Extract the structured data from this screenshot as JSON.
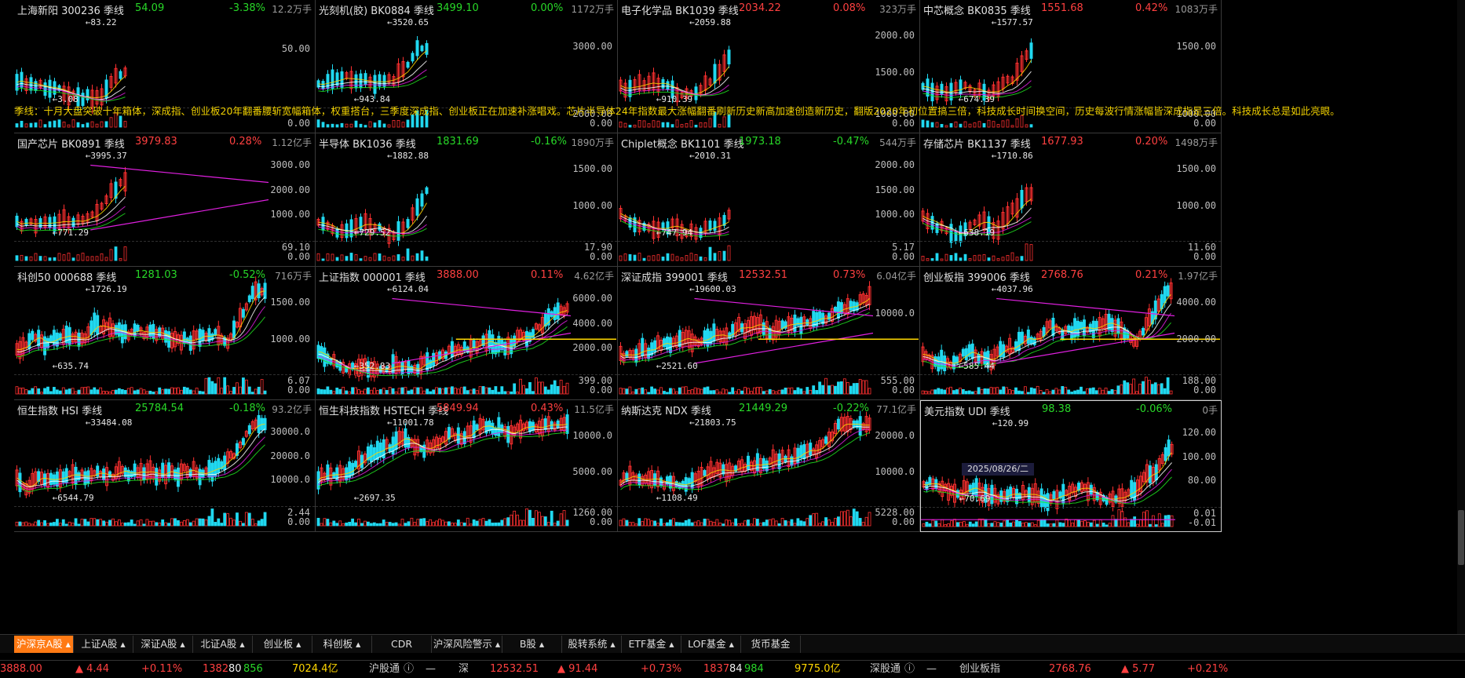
{
  "note": "季线：十月大盘突破十年箱体，深成指、创业板20年翻番腰斩宽幅箱体，权重搭台，三季度深成指、创业板正在加速补涨唱戏。芯片半导体24年指数最大涨幅翻番刷新历史新高加速创造新历史，翻版2020年初位置搞三倍，科技成长时间换空间，历史每波行情涨幅皆深成指是三倍。科技成长总是如此亮眼。",
  "date_label": "2025/08/26/二",
  "panels": [
    {
      "name": "上海新阳 300236 季线",
      "price": "54.09",
      "change": "-3.38%",
      "vol": "12.2万手",
      "y": [
        "50.00",
        "0.00"
      ],
      "high": "83.22",
      "low": "3.08"
    },
    {
      "name": "光刻机(胶) BK0884 季线",
      "price": "3499.10",
      "change": "0.00%",
      "vol": "1172万手",
      "y": [
        "3000.00",
        "2000.00",
        "0.00"
      ],
      "high": "3520.65",
      "low": "943.84"
    },
    {
      "name": "电子化学品 BK1039 季线",
      "price": "2034.22",
      "change": "0.08%",
      "vol": "323万手",
      "y": [
        "2000.00",
        "1500.00",
        "1000.00",
        "0.00"
      ],
      "high": "2059.88",
      "low": "910.39"
    },
    {
      "name": "中芯概念 BK0835 季线",
      "price": "1551.68",
      "change": "0.42%",
      "vol": "1083万手",
      "y": [
        "1500.00",
        "1000.00",
        "0.00"
      ],
      "high": "1577.57",
      "low": "674.39"
    },
    {
      "name": "国产芯片 BK0891 季线",
      "price": "3979.83",
      "change": "0.28%",
      "vol": "1.12亿手",
      "y": [
        "3000.00",
        "2000.00",
        "1000.00",
        "69.10",
        "0.00"
      ],
      "high": "3995.37",
      "low": "771.29"
    },
    {
      "name": "半导体 BK1036 季线",
      "price": "1831.69",
      "change": "-0.16%",
      "vol": "1890万手",
      "y": [
        "1500.00",
        "1000.00",
        "17.90",
        "0.00"
      ],
      "high": "1882.88",
      "low": "729.52"
    },
    {
      "name": "Chiplet概念 BK1101 季线",
      "price": "1973.18",
      "change": "-0.47%",
      "vol": "544万手",
      "y": [
        "2000.00",
        "1500.00",
        "1000.00",
        "5.17",
        "0.00"
      ],
      "high": "2010.31",
      "low": "747.94"
    },
    {
      "name": "存储芯片 BK1137 季线",
      "price": "1677.93",
      "change": "0.20%",
      "vol": "1498万手",
      "y": [
        "1500.00",
        "1000.00",
        "11.60",
        "0.00"
      ],
      "high": "1710.86",
      "low": "638.19"
    },
    {
      "name": "科创50 000688 季线",
      "price": "1281.03",
      "change": "-0.52%",
      "vol": "716万手",
      "y": [
        "1500.00",
        "1000.00",
        "6.07",
        "0.00"
      ],
      "high": "1726.19",
      "low": "635.74"
    },
    {
      "name": "上证指数 000001 季线",
      "price": "3888.00",
      "change": "0.11%",
      "vol": "4.62亿手",
      "y": [
        "6000.00",
        "4000.00",
        "2000.00",
        "399.00",
        "0.00"
      ],
      "high": "6124.04",
      "low": "352.83"
    },
    {
      "name": "深证成指 399001 季线",
      "price": "12532.51",
      "change": "0.73%",
      "vol": "6.04亿手",
      "y": [
        "10000.0",
        "555.00",
        "0.00"
      ],
      "high": "19600.03",
      "low": "2521.60"
    },
    {
      "name": "创业板指 399006 季线",
      "price": "2768.76",
      "change": "0.21%",
      "vol": "1.97亿手",
      "y": [
        "4000.00",
        "2000.00",
        "188.00",
        "0.00"
      ],
      "high": "4037.96",
      "low": "585.44"
    },
    {
      "name": "恒生指数 HSI 季线",
      "price": "25784.54",
      "change": "-0.18%",
      "vol": "93.2亿手",
      "y": [
        "30000.0",
        "20000.0",
        "10000.0",
        "2.44",
        "0.00"
      ],
      "high": "33484.08",
      "low": "6544.79"
    },
    {
      "name": "恒生科技指数 HSTECH 季线",
      "price": "5849.94",
      "change": "0.43%",
      "vol": "11.5亿手",
      "y": [
        "10000.0",
        "5000.00",
        "1260.00",
        "0.00"
      ],
      "high": "11001.78",
      "low": "2697.35"
    },
    {
      "name": "纳斯达克 NDX 季线",
      "price": "21449.29",
      "change": "-0.22%",
      "vol": "77.1亿手",
      "y": [
        "20000.0",
        "10000.0",
        "5228.00",
        "0.00"
      ],
      "high": "21803.75",
      "low": "1108.49"
    },
    {
      "name": "美元指数 UDI 季线",
      "price": "98.38",
      "change": "-0.06%",
      "vol": "0手",
      "y": [
        "120.00",
        "100.00",
        "80.00",
        "0.01",
        "-0.01"
      ],
      "high": "120.99",
      "low": "70.69"
    }
  ],
  "tabs": [
    "沪深京A股",
    "上证A股",
    "深证A股",
    "北证A股",
    "创业板",
    "科创板",
    "CDR",
    "沪深风险警示",
    "B股",
    "股转系统",
    "ETF基金",
    "LOF基金",
    "货币基金"
  ],
  "status": {
    "sh_price": "3888.00",
    "sh_delta": "▲ 4.44",
    "sh_pct": "+0.11%",
    "sh_up": "1382",
    "sh_flat": "80",
    "sh_down": "856",
    "sh_amt": "7024.4亿",
    "hgt": "沪股通",
    "hgt_val": "—",
    "sz_label": "深",
    "sz_price": "12532.51",
    "sz_delta": "▲ 91.44",
    "sz_pct": "+0.73%",
    "sz_up": "1837",
    "sz_flat": "84",
    "sz_down": "984",
    "sz_amt": "9775.0亿",
    "sgt": "深股通",
    "sgt_val": "—",
    "cyb_label": "创业板指",
    "cyb_price": "2768.76",
    "cyb_delta": "▲ 5.77",
    "cyb_pct": "+0.21%"
  },
  "colors": {
    "up": "#ff4040",
    "down": "#28d828",
    "accent": "#ff7a14",
    "ma_yellow": "#ffd700",
    "trend": "#e020e0"
  }
}
